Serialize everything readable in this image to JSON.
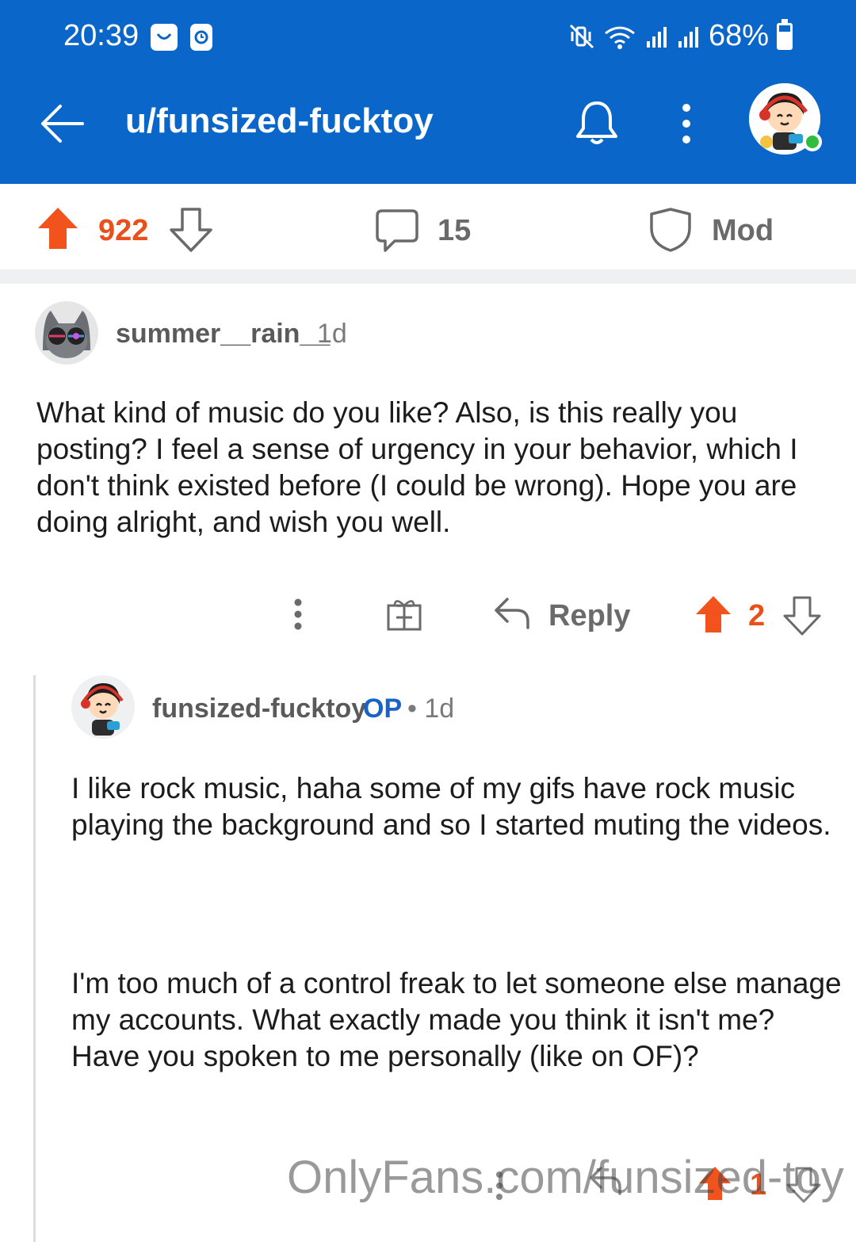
{
  "status_bar": {
    "time": "20:39",
    "battery": "68%"
  },
  "header": {
    "title": "u/funsized-fucktoy"
  },
  "post_actions": {
    "vote_count": "922",
    "comment_count": "15",
    "mod_label": "Mod"
  },
  "comments": [
    {
      "username": "summer__rain__",
      "age": "1d",
      "body": "What kind of music do you like? Also, is this really you posting? I feel a sense of urgency in your behavior, which I don't think existed before (I could be wrong). Hope you are doing alright, and wish you well.",
      "reply_label": "Reply",
      "vote_count": "2"
    },
    {
      "username": "funsized-fucktoy",
      "op_label": "OP",
      "age": "• 1d",
      "paragraph1": "I like rock music, haha some of my gifs have rock music playing the background and so I started muting the videos.",
      "paragraph2": "I'm too much of a control freak to let someone else manage my accounts. What exactly made you think it isn't me? Have you spoken to me personally (like on OF)?",
      "vote_count": "1"
    }
  ],
  "watermark": "OnlyFans.com/funsized-toy",
  "colors": {
    "header_bg": "#0a66c8",
    "upvote": "#e8501c",
    "op_badge": "#1a62c6"
  }
}
